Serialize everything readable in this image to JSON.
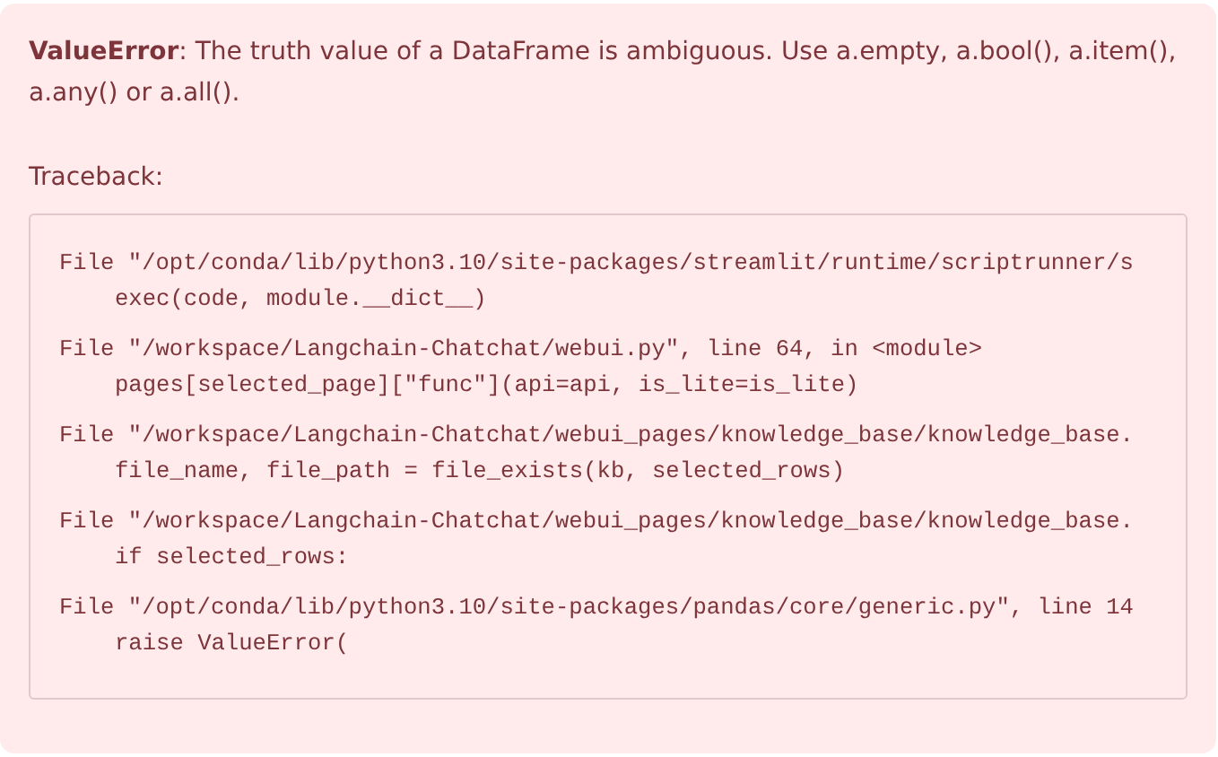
{
  "error_message": "**ValueError**: The truth value of a DataFrame is ambiguous. Use a.empty, a.bool(), a.item(), a.any() or a.all().",
  "traceback_label": "Traceback:",
  "traceback": [
    {
      "location": "File \"/opt/conda/lib/python3.10/site-packages/streamlit/runtime/scriptrunner/s",
      "code": "exec(code, module.__dict__)"
    },
    {
      "location": "File \"/workspace/Langchain-Chatchat/webui.py\", line 64, in <module>",
      "code": "pages[selected_page][\"func\"](api=api, is_lite=is_lite)"
    },
    {
      "location": "File \"/workspace/Langchain-Chatchat/webui_pages/knowledge_base/knowledge_base.",
      "code": "file_name, file_path = file_exists(kb, selected_rows)"
    },
    {
      "location": "File \"/workspace/Langchain-Chatchat/webui_pages/knowledge_base/knowledge_base.",
      "code": "if selected_rows:"
    },
    {
      "location": "File \"/opt/conda/lib/python3.10/site-packages/pandas/core/generic.py\", line 14",
      "code": "raise ValueError("
    }
  ]
}
